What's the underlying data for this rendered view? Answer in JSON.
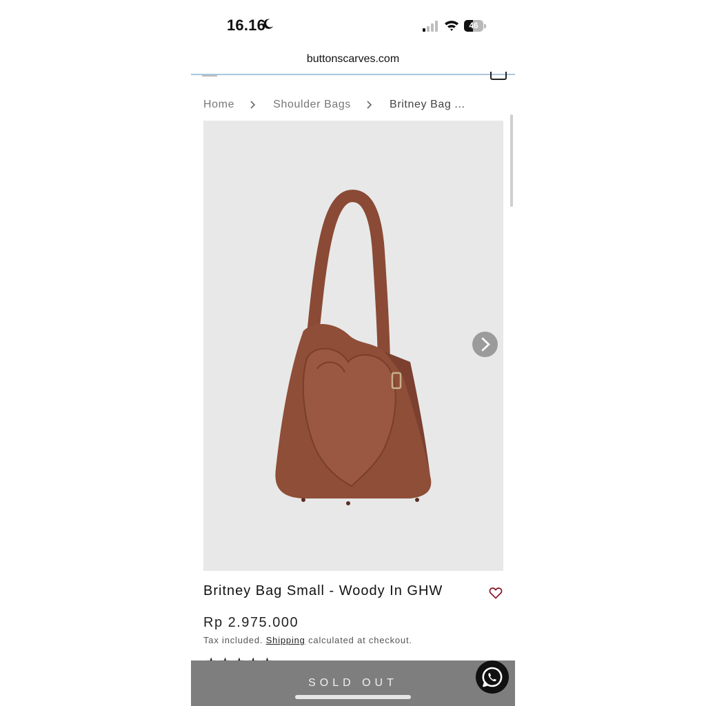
{
  "status_bar": {
    "time": "16.16",
    "battery": "46",
    "battery_level": 0.46
  },
  "browser": {
    "url": "buttonscarves.com"
  },
  "breadcrumb": {
    "items": [
      "Home",
      "Shoulder Bags",
      "Britney Bag ..."
    ]
  },
  "product": {
    "title": "Britney Bag Small - Woody In GHW",
    "price": "Rp 2.975.000",
    "tax_prefix": "Tax included.",
    "shipping_link": "Shipping",
    "tax_suffix": "calculated at checkout.",
    "rating_stars": "★★★★★",
    "image_alt": "brown leather bucket bag"
  },
  "actions": {
    "sold_out_label": "SOLD OUT"
  },
  "colors": {
    "accent_gray": "#7e7e7e",
    "bag_brown": "#8f4e38",
    "image_bg": "#e8e8e8"
  }
}
